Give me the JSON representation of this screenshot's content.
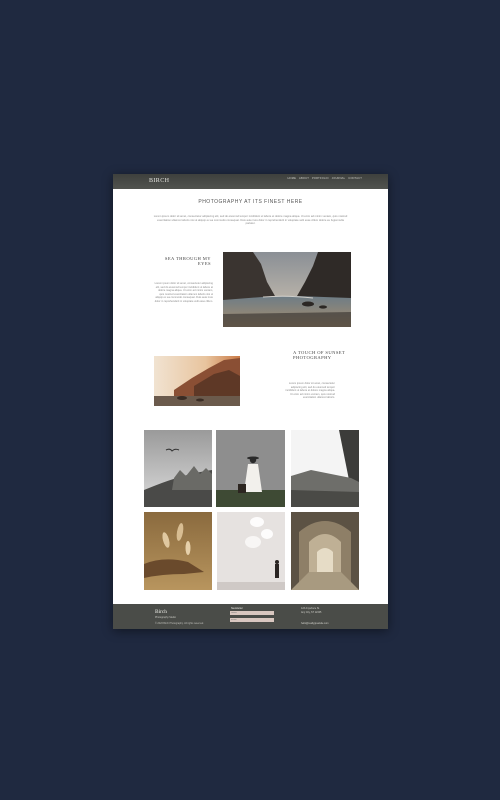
{
  "site": {
    "logo": "BIRCH",
    "nav": [
      "HOME",
      "ABOUT",
      "PORTFOLIO",
      "JOURNAL",
      "CONTACT"
    ]
  },
  "main": {
    "title": "PHOTOGRAPHY AT ITS FINEST HERE",
    "intro": "Lorem ipsum dolor sit amet, consectetur adipiscing elit, sed do eiusmod tempor incididunt ut labore et dolore magna aliqua. Ut enim ad minim veniam, quis nostrud exercitation ullamco laboris nisi ut aliquip ex ea commodo consequat. Duis aute irure dolor in reprehenderit in voluptate velit esse cillum dolore eu fugiat nulla pariatur."
  },
  "sections": [
    {
      "title": "SEA THROUGH MY EYES",
      "body": "Lorem ipsum dolor sit amet, consectetur adipiscing elit, sed do eiusmod tempor incididunt ut labore et dolore magna aliqua. Ut enim ad minim veniam, quis nostrud exercitation ullamco laboris nisi ut aliquip ex ea commodo consequat. Duis aute irure dolor in reprehenderit in voluptate velit esse cillum."
    },
    {
      "title": "A TOUCH OF SUNSET PHOTOGRAPHY",
      "body": "Lorem ipsum dolor sit amet, consectetur adipiscing elit, sed do eiusmod tempor incididunt ut labore et dolore magna aliqua. Ut enim ad minim veniam, quis nostrud exercitation ullamco laboris."
    }
  ],
  "gallery_icons": [
    "seagull-dunes-photo",
    "woman-suitcase-photo",
    "rock-arch-photo",
    "pampas-grass-photo",
    "wall-shadow-photo",
    "archway-corridor-photo"
  ],
  "footer": {
    "brand": "Birch",
    "tagline": "Photography Studio",
    "copyright": "© 2023 Birch Photography. All rights reserved.",
    "newsletter_label": "Newsletter",
    "name_placeholder": "Name",
    "email_placeholder": "Email",
    "address": "123 Anywhere St.",
    "city": "Any City, ST 12345",
    "email": "hello@reallygreatsite.com"
  },
  "colors": {
    "background": "#1f2940",
    "header": "#474945",
    "footer": "#4a4c48",
    "input": "#d9c7c0"
  }
}
